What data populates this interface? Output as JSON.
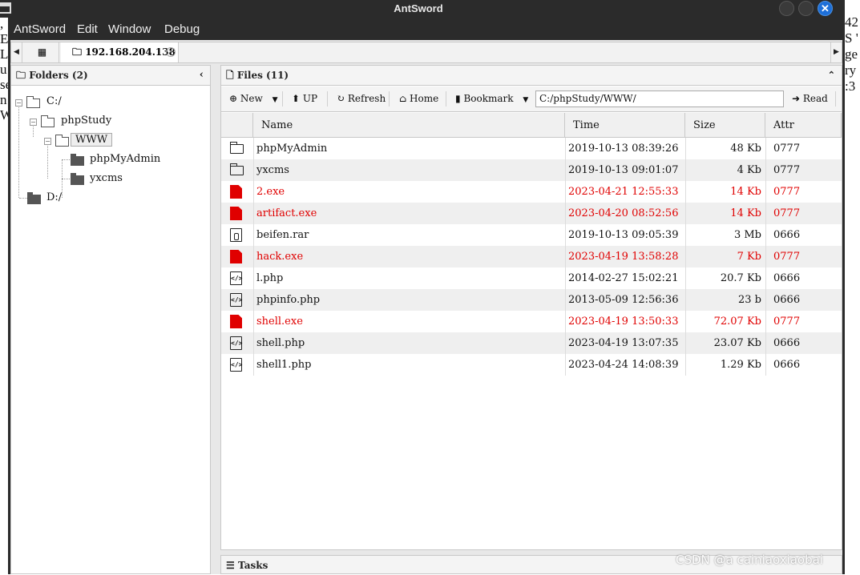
{
  "window": {
    "title": "AntSword"
  },
  "menu": [
    "AntSword",
    "Edit",
    "Window",
    "Debug"
  ],
  "background": {
    "left_fragments": [
      ",",
      "E",
      "L",
      "u",
      "se",
      "n",
      "",
      "W"
    ],
    "right_fragments": [
      "42",
      "S '",
      "ge",
      "ry",
      ":3"
    ]
  },
  "tabs": {
    "connection_label": "192.168.204.138"
  },
  "folders": {
    "header": "Folders (2)",
    "tree": {
      "c_drive": "C:/",
      "phpstudy": "phpStudy",
      "www": "WWW",
      "phpmyadmin": "phpMyAdmin",
      "yxcms": "yxcms",
      "d_drive": "D:/"
    }
  },
  "files": {
    "header": "Files (11)",
    "toolbar": {
      "new": "New",
      "up": "UP",
      "refresh": "Refresh",
      "home": "Home",
      "bookmark": "Bookmark",
      "path": "C:/phpStudy/WWW/",
      "read": "Read"
    },
    "columns": {
      "name": "Name",
      "time": "Time",
      "size": "Size",
      "attr": "Attr"
    },
    "rows": [
      {
        "icon": "folder-icon",
        "name": "phpMyAdmin",
        "time": "2019-10-13 08:39:26",
        "size": "48 Kb",
        "attr": "0777",
        "highlight": false
      },
      {
        "icon": "folder-icon",
        "name": "yxcms",
        "time": "2019-10-13 09:01:07",
        "size": "4 Kb",
        "attr": "0777",
        "highlight": false
      },
      {
        "icon": "exe-icon",
        "name": "2.exe",
        "time": "2023-04-21 12:55:33",
        "size": "14 Kb",
        "attr": "0777",
        "highlight": true
      },
      {
        "icon": "exe-icon",
        "name": "artifact.exe",
        "time": "2023-04-20 08:52:56",
        "size": "14 Kb",
        "attr": "0777",
        "highlight": true
      },
      {
        "icon": "archive-icon",
        "name": "beifen.rar",
        "time": "2019-10-13 09:05:39",
        "size": "3 Mb",
        "attr": "0666",
        "highlight": false
      },
      {
        "icon": "exe-icon",
        "name": "hack.exe",
        "time": "2023-04-19 13:58:28",
        "size": "7 Kb",
        "attr": "0777",
        "highlight": true
      },
      {
        "icon": "code-file-icon",
        "name": "l.php",
        "time": "2014-02-27 15:02:21",
        "size": "20.7 Kb",
        "attr": "0666",
        "highlight": false
      },
      {
        "icon": "code-file-icon",
        "name": "phpinfo.php",
        "time": "2013-05-09 12:56:36",
        "size": "23 b",
        "attr": "0666",
        "highlight": false
      },
      {
        "icon": "exe-icon",
        "name": "shell.exe",
        "time": "2023-04-19 13:50:33",
        "size": "72.07 Kb",
        "attr": "0777",
        "highlight": true
      },
      {
        "icon": "code-file-icon",
        "name": "shell.php",
        "time": "2023-04-19 13:07:35",
        "size": "23.07 Kb",
        "attr": "0666",
        "highlight": false
      },
      {
        "icon": "code-file-icon",
        "name": "shell1.php",
        "time": "2023-04-24 14:08:39",
        "size": "1.29 Kb",
        "attr": "0666",
        "highlight": false
      }
    ]
  },
  "tasks": {
    "header": "Tasks"
  },
  "watermark": "CSDN @a cainiaoxiaobai",
  "colors": {
    "highlight": "#e00000",
    "close_button": "#1d6fd8"
  }
}
